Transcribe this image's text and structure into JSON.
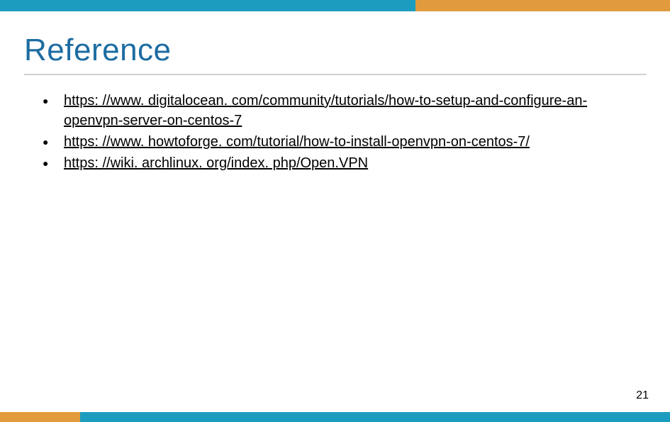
{
  "title": "Reference",
  "references": [
    "https: //www. digitalocean. com/community/tutorials/how-to-setup-and-configure-an-openvpn-server-on-centos-7",
    "https: //www. howtoforge. com/tutorial/how-to-install-openvpn-on-centos-7/",
    "https: //wiki. archlinux. org/index. php/Open.VPN"
  ],
  "page_number": "21"
}
